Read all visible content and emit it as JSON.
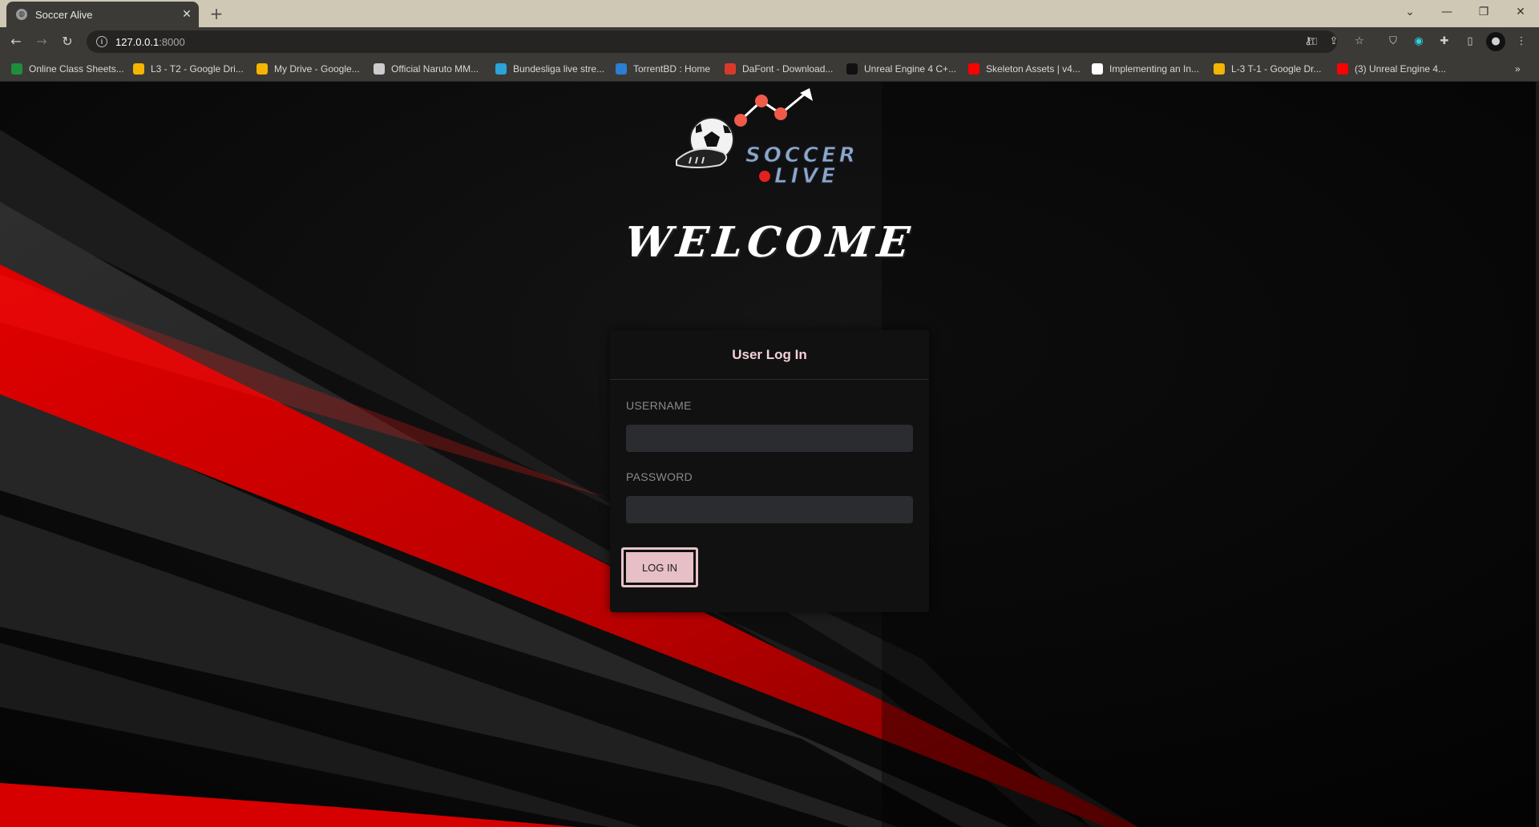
{
  "browser": {
    "tab_title": "Soccer Alive",
    "url_host": "127.0.0.1",
    "url_port": ":8000",
    "bookmarks": [
      {
        "label": "Online Class Sheets...",
        "color": "#1e8e3e"
      },
      {
        "label": "L3 - T2 - Google Dri...",
        "color": "#f4b400"
      },
      {
        "label": "My Drive - Google...",
        "color": "#f4b400"
      },
      {
        "label": "Official Naruto MM...",
        "color": "#cccccc"
      },
      {
        "label": "Bundesliga live stre...",
        "color": "#2aa4d8"
      },
      {
        "label": "TorrentBD : Home",
        "color": "#2a7fd4"
      },
      {
        "label": "DaFont - Download...",
        "color": "#d83a2a"
      },
      {
        "label": "Unreal Engine 4 C+...",
        "color": "#111111"
      },
      {
        "label": "Skeleton Assets | v4...",
        "color": "#ff0000"
      },
      {
        "label": "Implementing an In...",
        "color": "#ffffff"
      },
      {
        "label": "L-3 T-1 - Google Dr...",
        "color": "#f4b400"
      },
      {
        "label": "(3) Unreal Engine 4...",
        "color": "#ff0000"
      }
    ]
  },
  "page": {
    "logo_text_1": "SOCCER",
    "logo_text_2": "LIVE",
    "welcome": "WELCOME",
    "login": {
      "header": "User Log In",
      "username_label": "USERNAME",
      "username_value": "",
      "password_label": "PASSWORD",
      "password_value": "",
      "submit_label": "LOG IN"
    }
  },
  "colors": {
    "accent_red": "#d40000",
    "button_pink": "#e7bfc6",
    "card_bg": "#111111"
  }
}
